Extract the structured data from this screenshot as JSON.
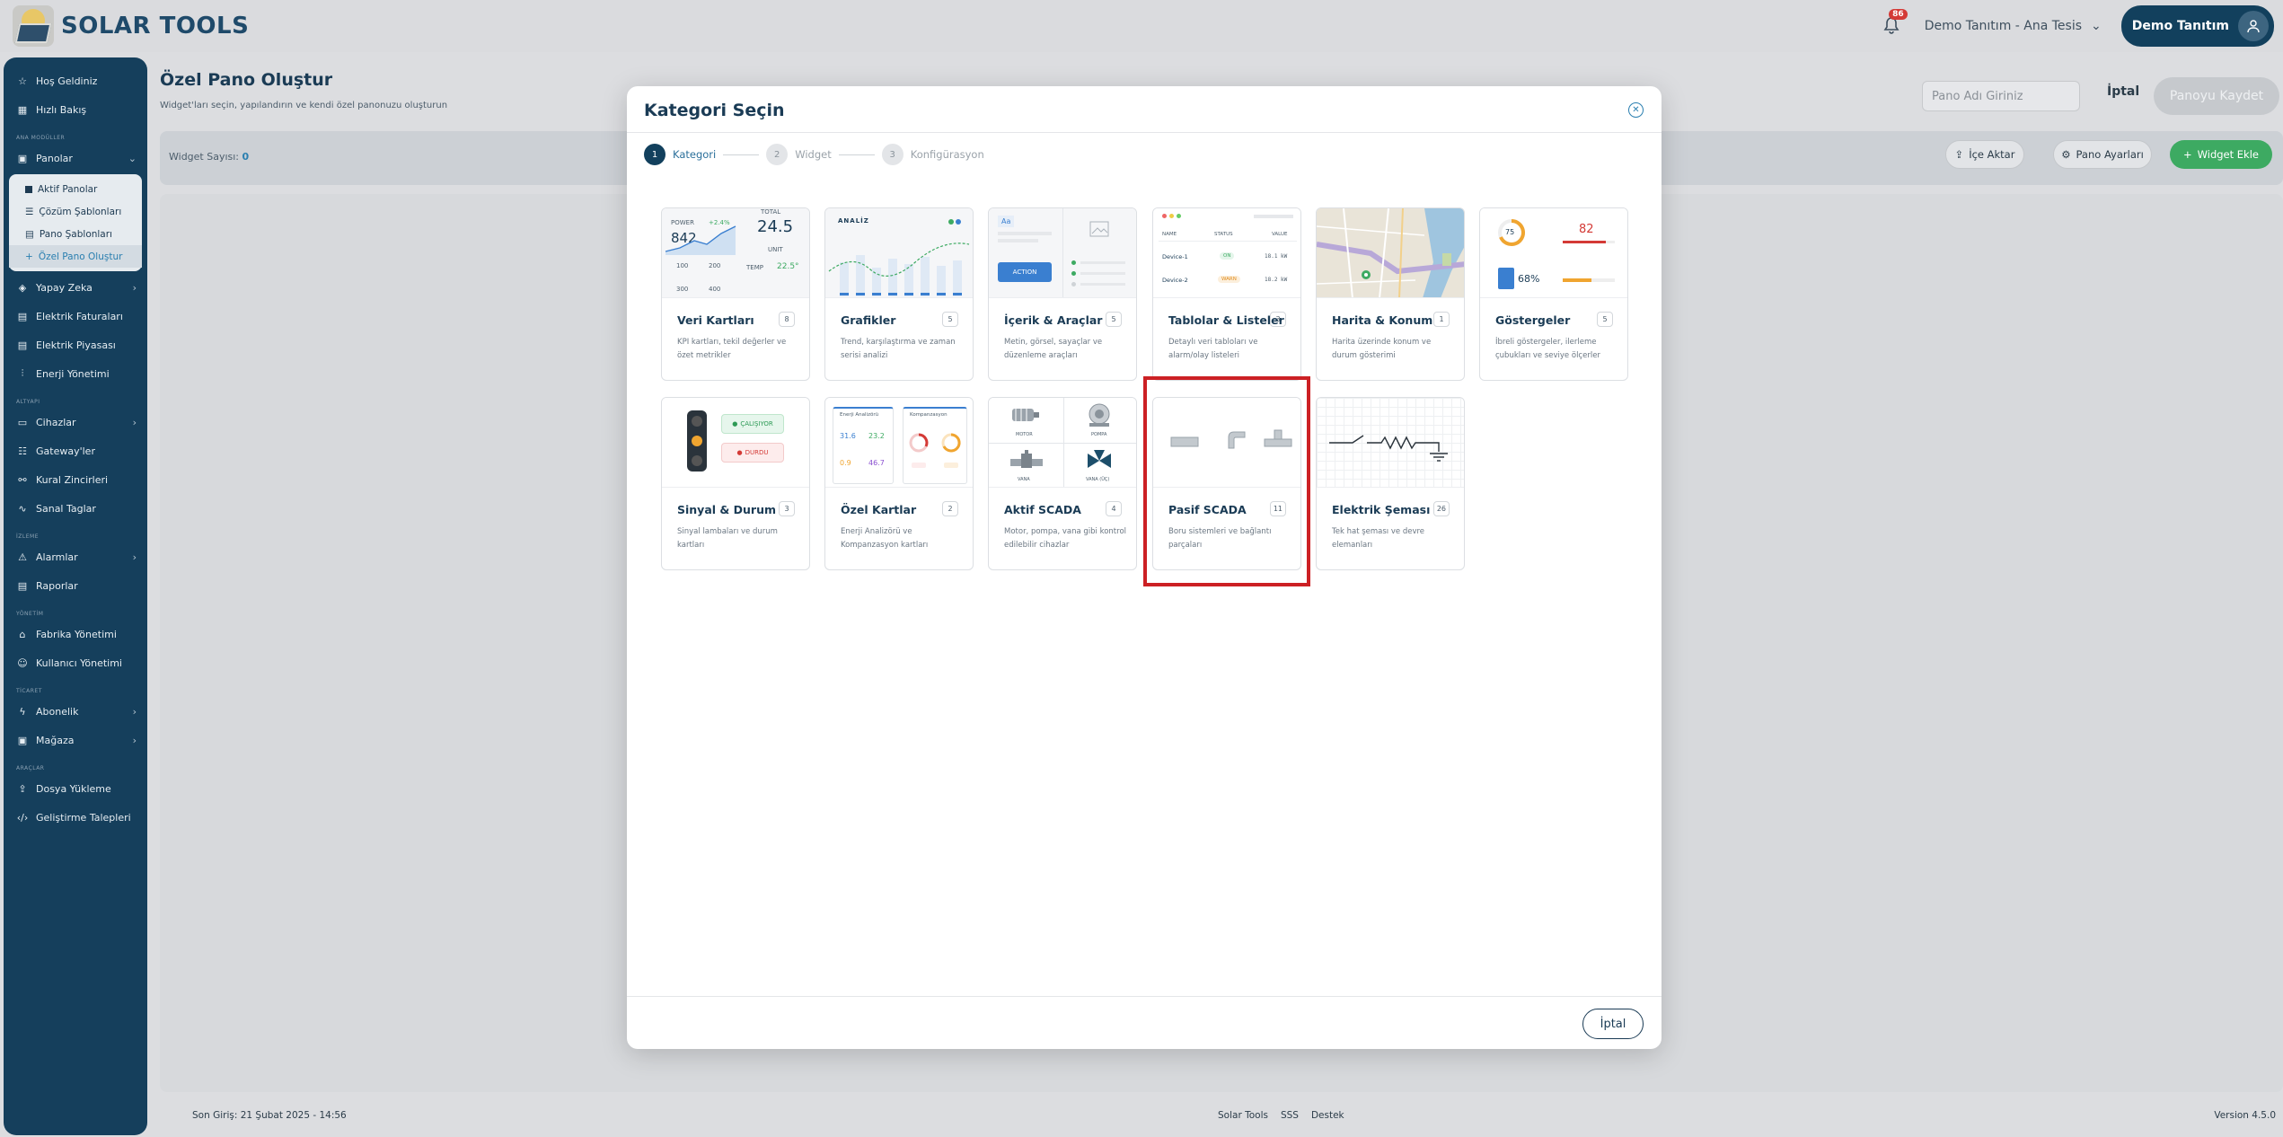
{
  "app": {
    "logo_text": "SOLAR TOOLS"
  },
  "topbar": {
    "notification_count": "86",
    "facility": "Demo Tanıtım - Ana Tesis",
    "user": "Demo Tanıtım"
  },
  "sidebar": {
    "top_items": [
      {
        "label": "Hoş Geldiniz",
        "icon": "star-icon"
      },
      {
        "label": "Hızlı Bakış",
        "icon": "grid-icon"
      }
    ],
    "section_main": "ANA MODÜLLER",
    "panolar": {
      "label": "Panolar",
      "icon": "dashboard-icon"
    },
    "panolar_sub": [
      "Aktif Panolar",
      "Çözüm Şablonları",
      "Pano Şablonları",
      "Özel Pano Oluştur"
    ],
    "main_items": [
      {
        "label": "Yapay Zeka",
        "icon": "ai-icon",
        "chevron": true
      },
      {
        "label": "Elektrik Faturaları",
        "icon": "invoice-icon"
      },
      {
        "label": "Elektrik Piyasası",
        "icon": "market-icon"
      },
      {
        "label": "Enerji Yönetimi",
        "icon": "sliders-icon"
      }
    ],
    "section_infra": "ALTYAPI",
    "infra_items": [
      {
        "label": "Cihazlar",
        "icon": "monitor-icon",
        "chevron": true
      },
      {
        "label": "Gateway'ler",
        "icon": "server-icon"
      },
      {
        "label": "Kural Zincirleri",
        "icon": "chain-icon"
      },
      {
        "label": "Sanal Taglar",
        "icon": "pulse-icon"
      }
    ],
    "section_monitor": "İZLEME",
    "monitor_items": [
      {
        "label": "Alarmlar",
        "icon": "alarm-icon",
        "chevron": true
      },
      {
        "label": "Raporlar",
        "icon": "report-icon"
      }
    ],
    "section_manage": "YÖNETİM",
    "manage_items": [
      {
        "label": "Fabrika Yönetimi",
        "icon": "factory-icon"
      },
      {
        "label": "Kullanıcı Yönetimi",
        "icon": "users-icon"
      }
    ],
    "section_trade": "TİCARET",
    "trade_items": [
      {
        "label": "Abonelik",
        "icon": "bolt-icon",
        "chevron": true
      },
      {
        "label": "Mağaza",
        "icon": "store-icon",
        "chevron": true
      }
    ],
    "section_tools": "ARAÇLAR",
    "tools_items": [
      {
        "label": "Dosya Yükleme",
        "icon": "upload-icon"
      },
      {
        "label": "Geliştirme Talepleri",
        "icon": "code-icon"
      }
    ]
  },
  "page": {
    "title": "Özel Pano Oluştur",
    "subtitle": "Widget'ları seçin, yapılandırın ve kendi özel panonuzu oluşturun",
    "board_name_placeholder": "Pano Adı Giriniz",
    "cancel": "İptal",
    "save": "Panoyu Kaydet",
    "widget_count_label": "Widget Sayısı:",
    "widget_count": "0",
    "import": "İçe Aktar",
    "settings": "Pano Ayarları",
    "add_widget": "Widget Ekle"
  },
  "footer": {
    "last_login": "Son Giriş: 21 Şubat 2025 - 14:56",
    "links": [
      "Solar Tools",
      "SSS",
      "Destek"
    ],
    "version": "Version 4.5.0"
  },
  "modal": {
    "title": "Kategori Seçin",
    "steps": [
      {
        "num": "1",
        "label": "Kategori"
      },
      {
        "num": "2",
        "label": "Widget"
      },
      {
        "num": "3",
        "label": "Konfigürasyon"
      }
    ],
    "cancel": "İptal",
    "categories": [
      {
        "title": "Veri Kartları",
        "count": "8",
        "desc": "KPI kartları, tekil değerler ve özet metrikler"
      },
      {
        "title": "Grafikler",
        "count": "5",
        "desc": "Trend, karşılaştırma ve zaman serisi analizi"
      },
      {
        "title": "İçerik & Araçlar",
        "count": "5",
        "desc": "Metin, görsel, sayaçlar ve düzenleme araçları"
      },
      {
        "title": "Tablolar & Listeler",
        "count": "3",
        "desc": "Detaylı veri tabloları ve alarm/olay listeleri"
      },
      {
        "title": "Harita & Konum",
        "count": "1",
        "desc": "Harita üzerinde konum ve durum gösterimi"
      },
      {
        "title": "Göstergeler",
        "count": "5",
        "desc": "İbreli göstergeler, ilerleme çubukları ve seviye ölçerler"
      },
      {
        "title": "Sinyal & Durum",
        "count": "3",
        "desc": "Sinyal lambaları ve durum kartları"
      },
      {
        "title": "Özel Kartlar",
        "count": "2",
        "desc": "Enerji Analizörü ve Kompanzasyon kartları"
      },
      {
        "title": "Aktif SCADA",
        "count": "4",
        "desc": "Motor, pompa, vana gibi kontrol edilebilir cihazlar"
      },
      {
        "title": "Pasif SCADA",
        "count": "11",
        "desc": "Boru sistemleri ve bağlantı parçaları"
      },
      {
        "title": "Elektrik Şeması",
        "count": "26",
        "desc": "Tek hat şeması ve devre elemanları"
      }
    ],
    "thumbs": {
      "veri": {
        "power": "POWER",
        "delta": "+2.4%",
        "power_val": "842",
        "total": "TOTAL",
        "big": "24.5",
        "unit": "UNIT",
        "temp": "TEMP",
        "temp_val": "22.5°",
        "nums": [
          "100",
          "200",
          "300",
          "400"
        ]
      },
      "grafik": {
        "label": "ANALİZ"
      },
      "icerik": {
        "aa": "Aa",
        "action": "ACTION"
      },
      "tablo": {
        "headers": [
          "NAME",
          "STATUS",
          "VALUE"
        ],
        "rows": [
          [
            "Device-1",
            "ON",
            "18.1 kW"
          ],
          [
            "Device-2",
            "WARN",
            "18.2 kW"
          ]
        ]
      },
      "gosterge": {
        "g1": "75",
        "g2": "82",
        "g3": "68%"
      },
      "sinyal": {
        "on": "ÇALIŞIYOR",
        "off": "DURDU"
      },
      "ozel": {
        "a": "Enerji Analizörü",
        "b": "Kompanzasyon",
        "vals": [
          "31.6",
          "23.2",
          "0.9",
          "46.7"
        ]
      },
      "scada": {
        "labels": [
          "MOTOR",
          "POMPA",
          "VANA",
          "VANA (ÜÇ)"
        ]
      }
    }
  }
}
